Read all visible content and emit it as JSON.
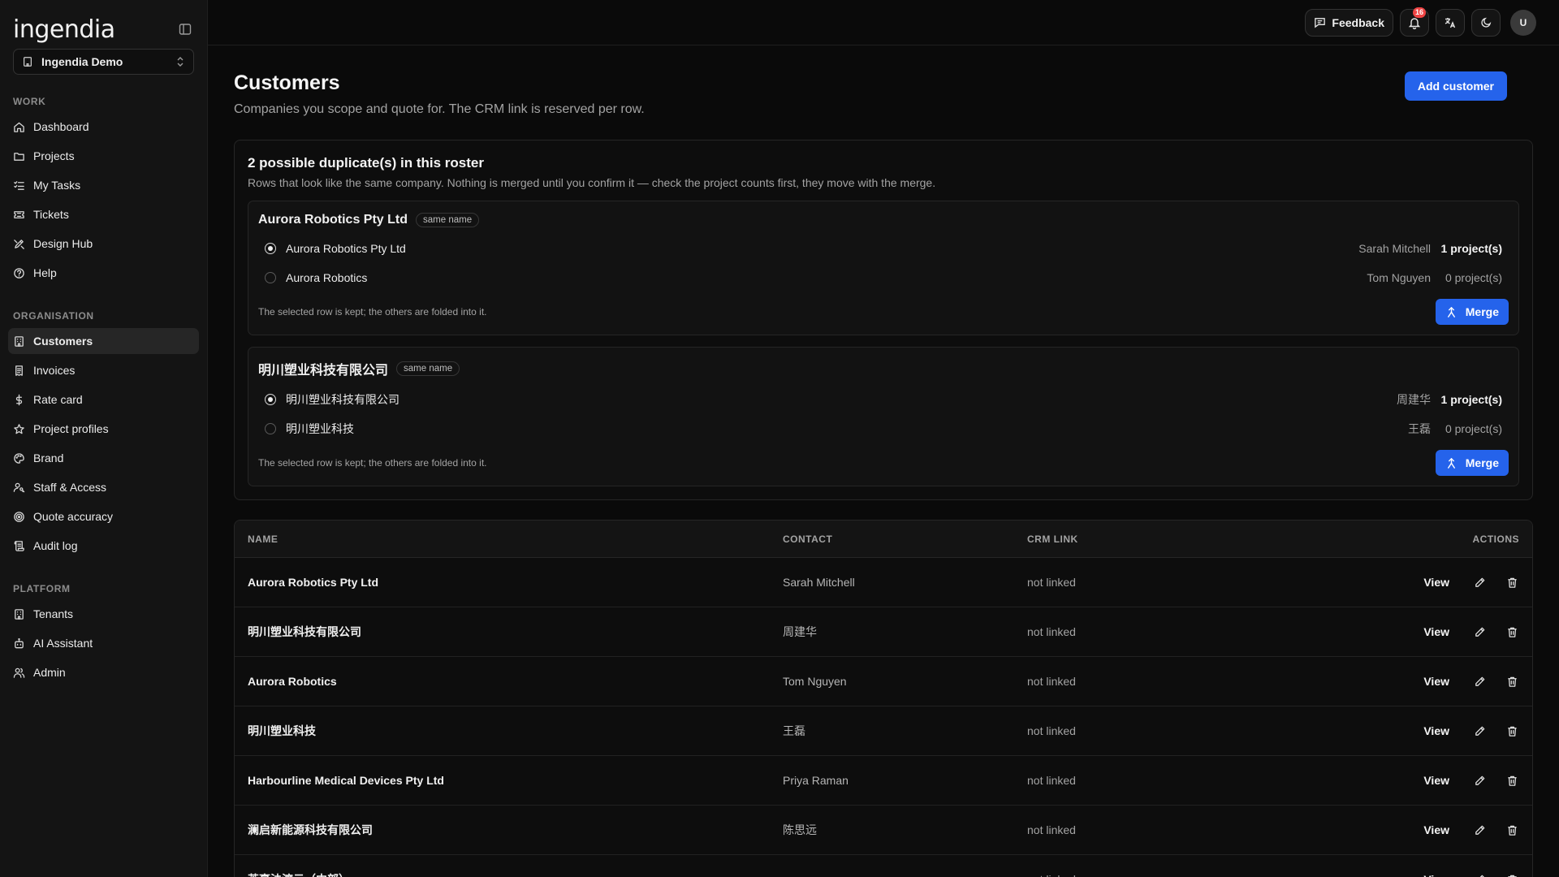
{
  "app": {
    "logo": "ingendia",
    "tenant": "Ingendia Demo"
  },
  "sidebar": {
    "sections": [
      {
        "label": "WORK",
        "items": [
          {
            "label": "Dashboard",
            "icon": "home-icon"
          },
          {
            "label": "Projects",
            "icon": "folder-icon"
          },
          {
            "label": "My Tasks",
            "icon": "list-checks-icon"
          },
          {
            "label": "Tickets",
            "icon": "ticket-icon"
          },
          {
            "label": "Design Hub",
            "icon": "design-icon"
          },
          {
            "label": "Help",
            "icon": "help-circle-icon"
          }
        ]
      },
      {
        "label": "ORGANISATION",
        "items": [
          {
            "label": "Customers",
            "icon": "building-icon",
            "active": true
          },
          {
            "label": "Invoices",
            "icon": "receipt-icon"
          },
          {
            "label": "Rate card",
            "icon": "dollar-icon"
          },
          {
            "label": "Project profiles",
            "icon": "star-icon"
          },
          {
            "label": "Brand",
            "icon": "palette-icon"
          },
          {
            "label": "Staff & Access",
            "icon": "user-key-icon"
          },
          {
            "label": "Quote accuracy",
            "icon": "target-icon"
          },
          {
            "label": "Audit log",
            "icon": "scroll-icon"
          }
        ]
      },
      {
        "label": "PLATFORM",
        "items": [
          {
            "label": "Tenants",
            "icon": "building-icon"
          },
          {
            "label": "AI Assistant",
            "icon": "bot-icon"
          },
          {
            "label": "Admin",
            "icon": "users-icon"
          }
        ]
      }
    ]
  },
  "topbar": {
    "feedback_label": "Feedback",
    "notification_count": "16",
    "avatar_initial": "U"
  },
  "page": {
    "title": "Customers",
    "subtitle": "Companies you scope and quote for. The CRM link is reserved per row.",
    "add_button": "Add customer"
  },
  "duplicates": {
    "title": "2 possible duplicate(s) in this roster",
    "description": "Rows that look like the same company. Nothing is merged until you confirm it — check the project counts first, they move with the merge.",
    "groups": [
      {
        "name": "Aurora Robotics Pty Ltd",
        "tag": "same name",
        "candidates": [
          {
            "name": "Aurora Robotics Pty Ltd",
            "contact": "Sarah Mitchell",
            "projects": "1 project(s)",
            "selected": true
          },
          {
            "name": "Aurora Robotics",
            "contact": "Tom Nguyen",
            "projects": "0 project(s)",
            "selected": false
          }
        ],
        "note": "The selected row is kept; the others are folded into it.",
        "merge_label": "Merge"
      },
      {
        "name": "明川塑业科技有限公司",
        "tag": "same name",
        "candidates": [
          {
            "name": "明川塑业科技有限公司",
            "contact": "周建华",
            "projects": "1 project(s)",
            "selected": true
          },
          {
            "name": "明川塑业科技",
            "contact": "王磊",
            "projects": "0 project(s)",
            "selected": false
          }
        ],
        "note": "The selected row is kept; the others are folded into it.",
        "merge_label": "Merge"
      }
    ]
  },
  "table": {
    "columns": {
      "name": "NAME",
      "contact": "CONTACT",
      "crm": "CRM LINK",
      "actions": "ACTIONS"
    },
    "view_label": "View",
    "rows": [
      {
        "name": "Aurora Robotics Pty Ltd",
        "contact": "Sarah Mitchell",
        "crm": "not linked"
      },
      {
        "name": "明川塑业科技有限公司",
        "contact": "周建华",
        "crm": "not linked"
      },
      {
        "name": "Aurora Robotics",
        "contact": "Tom Nguyen",
        "crm": "not linked"
      },
      {
        "name": "明川塑业科技",
        "contact": "王磊",
        "crm": "not linked"
      },
      {
        "name": "Harbourline Medical Devices Pty Ltd",
        "contact": "Priya Raman",
        "crm": "not linked"
      },
      {
        "name": "澜启新能源科技有限公司",
        "contact": "陈思远",
        "crm": "not linked"
      },
      {
        "name": "英豪法渡云（中部）",
        "contact": "",
        "crm": "not linked"
      }
    ]
  }
}
